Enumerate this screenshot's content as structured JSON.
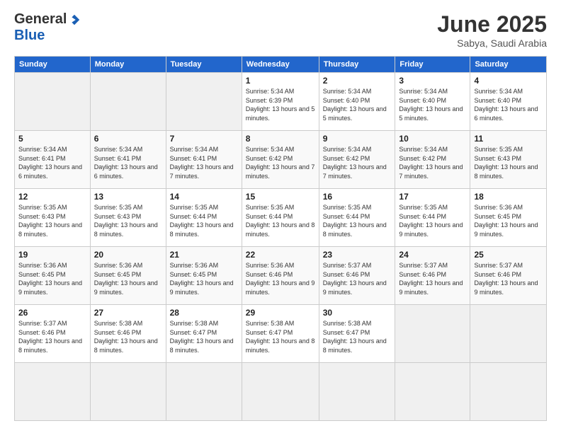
{
  "logo": {
    "general": "General",
    "blue": "Blue"
  },
  "title": "June 2025",
  "subtitle": "Sabya, Saudi Arabia",
  "weekdays": [
    "Sunday",
    "Monday",
    "Tuesday",
    "Wednesday",
    "Thursday",
    "Friday",
    "Saturday"
  ],
  "days": [
    null,
    null,
    null,
    {
      "num": "1",
      "sunrise": "5:34 AM",
      "sunset": "6:39 PM",
      "daylight": "13 hours and 5 minutes."
    },
    {
      "num": "2",
      "sunrise": "5:34 AM",
      "sunset": "6:40 PM",
      "daylight": "13 hours and 5 minutes."
    },
    {
      "num": "3",
      "sunrise": "5:34 AM",
      "sunset": "6:40 PM",
      "daylight": "13 hours and 5 minutes."
    },
    {
      "num": "4",
      "sunrise": "5:34 AM",
      "sunset": "6:40 PM",
      "daylight": "13 hours and 6 minutes."
    },
    {
      "num": "5",
      "sunrise": "5:34 AM",
      "sunset": "6:41 PM",
      "daylight": "13 hours and 6 minutes."
    },
    {
      "num": "6",
      "sunrise": "5:34 AM",
      "sunset": "6:41 PM",
      "daylight": "13 hours and 6 minutes."
    },
    {
      "num": "7",
      "sunrise": "5:34 AM",
      "sunset": "6:41 PM",
      "daylight": "13 hours and 7 minutes."
    },
    {
      "num": "8",
      "sunrise": "5:34 AM",
      "sunset": "6:42 PM",
      "daylight": "13 hours and 7 minutes."
    },
    {
      "num": "9",
      "sunrise": "5:34 AM",
      "sunset": "6:42 PM",
      "daylight": "13 hours and 7 minutes."
    },
    {
      "num": "10",
      "sunrise": "5:34 AM",
      "sunset": "6:42 PM",
      "daylight": "13 hours and 7 minutes."
    },
    {
      "num": "11",
      "sunrise": "5:35 AM",
      "sunset": "6:43 PM",
      "daylight": "13 hours and 8 minutes."
    },
    {
      "num": "12",
      "sunrise": "5:35 AM",
      "sunset": "6:43 PM",
      "daylight": "13 hours and 8 minutes."
    },
    {
      "num": "13",
      "sunrise": "5:35 AM",
      "sunset": "6:43 PM",
      "daylight": "13 hours and 8 minutes."
    },
    {
      "num": "14",
      "sunrise": "5:35 AM",
      "sunset": "6:44 PM",
      "daylight": "13 hours and 8 minutes."
    },
    {
      "num": "15",
      "sunrise": "5:35 AM",
      "sunset": "6:44 PM",
      "daylight": "13 hours and 8 minutes."
    },
    {
      "num": "16",
      "sunrise": "5:35 AM",
      "sunset": "6:44 PM",
      "daylight": "13 hours and 8 minutes."
    },
    {
      "num": "17",
      "sunrise": "5:35 AM",
      "sunset": "6:44 PM",
      "daylight": "13 hours and 9 minutes."
    },
    {
      "num": "18",
      "sunrise": "5:36 AM",
      "sunset": "6:45 PM",
      "daylight": "13 hours and 9 minutes."
    },
    {
      "num": "19",
      "sunrise": "5:36 AM",
      "sunset": "6:45 PM",
      "daylight": "13 hours and 9 minutes."
    },
    {
      "num": "20",
      "sunrise": "5:36 AM",
      "sunset": "6:45 PM",
      "daylight": "13 hours and 9 minutes."
    },
    {
      "num": "21",
      "sunrise": "5:36 AM",
      "sunset": "6:45 PM",
      "daylight": "13 hours and 9 minutes."
    },
    {
      "num": "22",
      "sunrise": "5:36 AM",
      "sunset": "6:46 PM",
      "daylight": "13 hours and 9 minutes."
    },
    {
      "num": "23",
      "sunrise": "5:37 AM",
      "sunset": "6:46 PM",
      "daylight": "13 hours and 9 minutes."
    },
    {
      "num": "24",
      "sunrise": "5:37 AM",
      "sunset": "6:46 PM",
      "daylight": "13 hours and 9 minutes."
    },
    {
      "num": "25",
      "sunrise": "5:37 AM",
      "sunset": "6:46 PM",
      "daylight": "13 hours and 9 minutes."
    },
    {
      "num": "26",
      "sunrise": "5:37 AM",
      "sunset": "6:46 PM",
      "daylight": "13 hours and 8 minutes."
    },
    {
      "num": "27",
      "sunrise": "5:38 AM",
      "sunset": "6:46 PM",
      "daylight": "13 hours and 8 minutes."
    },
    {
      "num": "28",
      "sunrise": "5:38 AM",
      "sunset": "6:47 PM",
      "daylight": "13 hours and 8 minutes."
    },
    {
      "num": "29",
      "sunrise": "5:38 AM",
      "sunset": "6:47 PM",
      "daylight": "13 hours and 8 minutes."
    },
    {
      "num": "30",
      "sunrise": "5:38 AM",
      "sunset": "6:47 PM",
      "daylight": "13 hours and 8 minutes."
    },
    null,
    null,
    null,
    null,
    null
  ]
}
